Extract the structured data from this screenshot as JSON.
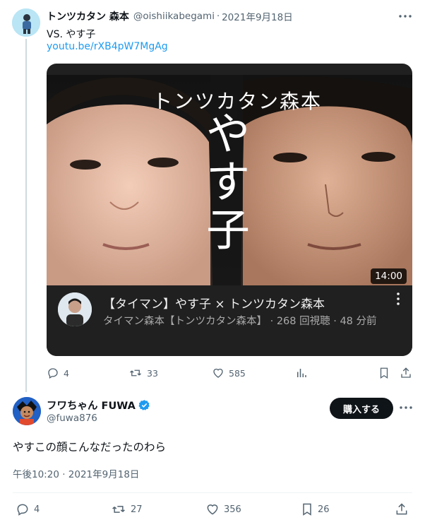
{
  "parent": {
    "name": "トンツカタン 森本",
    "handle": "@oishiikabegami",
    "separator": "·",
    "date": "2021年9月18日",
    "text": "VS. やす子",
    "link": "youtu.be/rXB4pW7MgAg",
    "card": {
      "thumb_text_top": "トンツカタン森本",
      "thumb_text_vertical": [
        "や",
        "す",
        "子"
      ],
      "duration": "14:00",
      "title": "【タイマン】やす子 × トンツカタン森本",
      "subtitle": "タイマン森本【トンツカタン森本】 · 268 回視聴 · 48 分前"
    },
    "actions": {
      "reply_count": "4",
      "retweet_count": "33",
      "like_count": "585"
    }
  },
  "reply": {
    "name": "フワちゃん FUWA",
    "verified": true,
    "handle": "@fuwa876",
    "button_label": "購入する",
    "text": "やすこの顔こんなだったのわら",
    "timestamp": "午後10:20 · 2021年9月18日",
    "actions": {
      "reply_count": "4",
      "retweet_count": "27",
      "like_count": "356",
      "bookmark_count": "26"
    }
  },
  "colors": {
    "accent_link": "#1d9bf0",
    "verified_badge": "#1d9bf0",
    "muted_text": "#536471",
    "card_bg": "#202020"
  },
  "icons": [
    "more-icon",
    "reply-icon",
    "retweet-icon",
    "like-icon",
    "views-icon",
    "bookmark-icon",
    "share-icon",
    "verified-icon",
    "kebab-icon"
  ]
}
